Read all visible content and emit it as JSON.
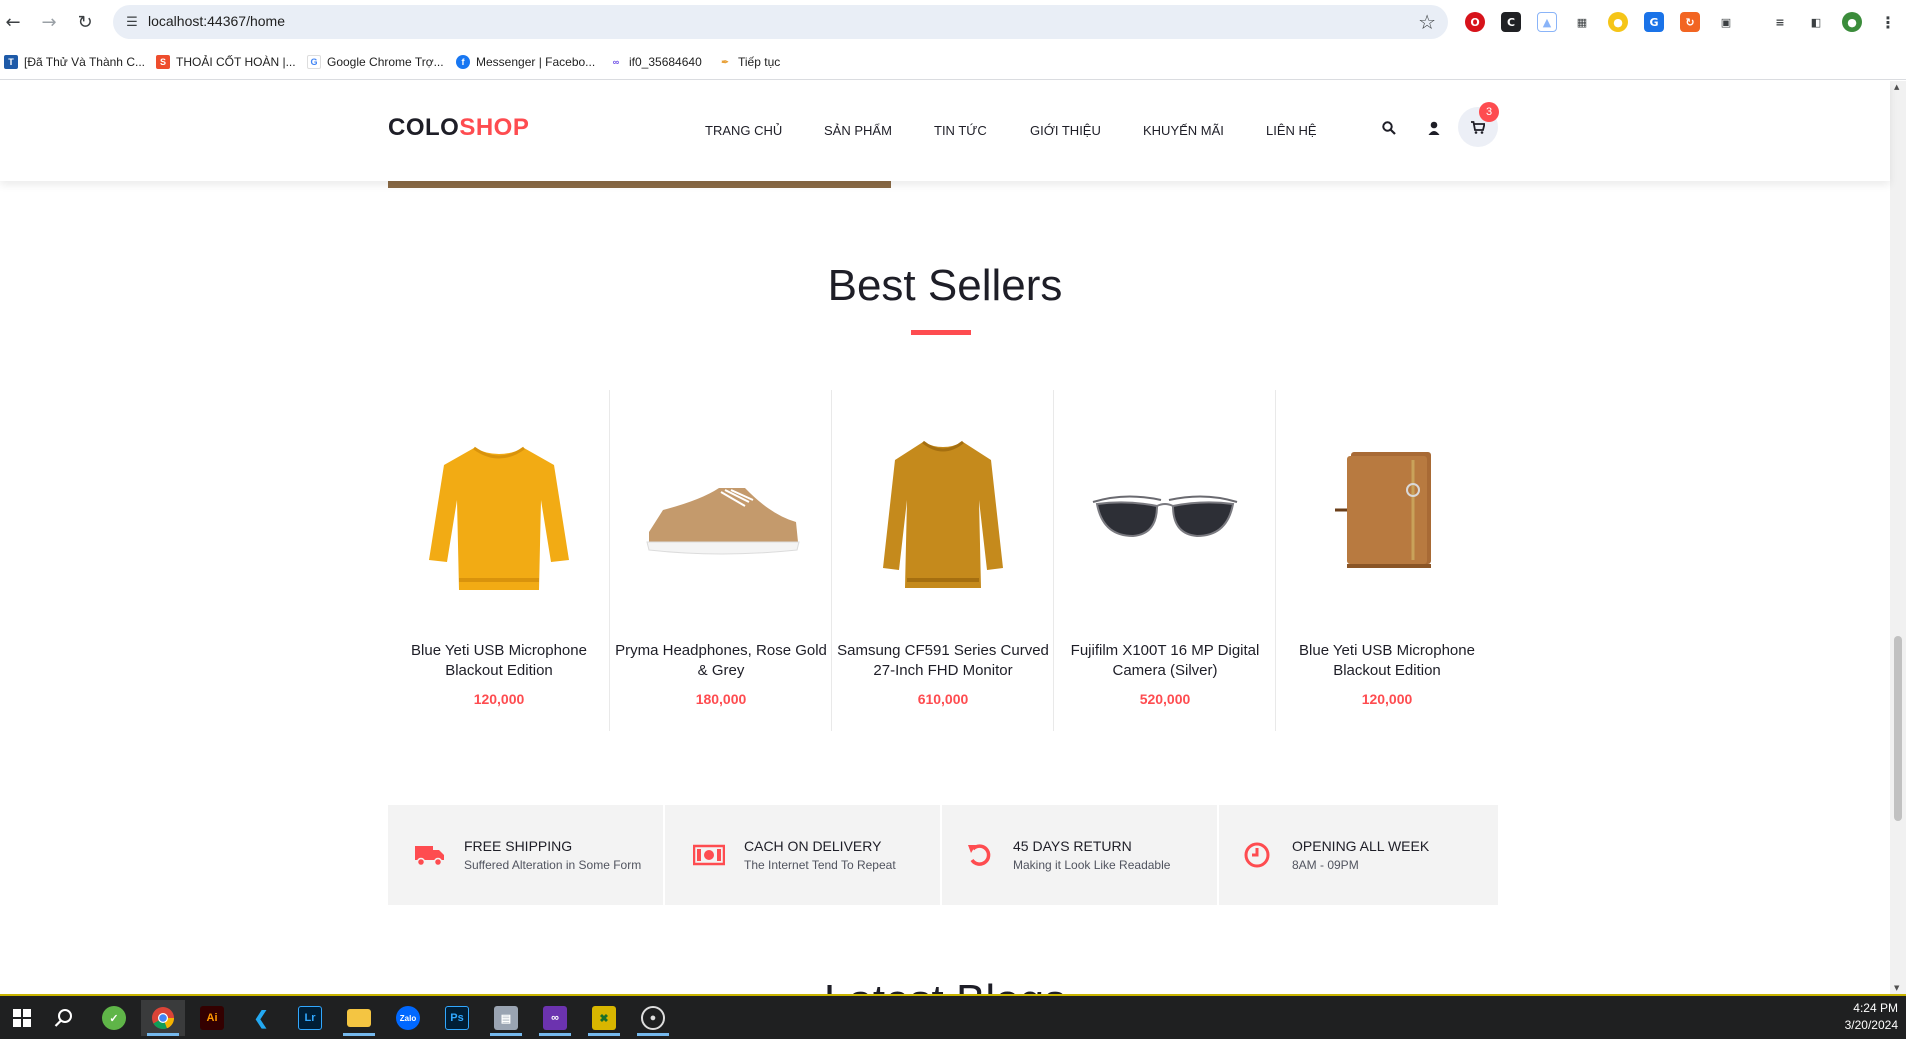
{
  "browser": {
    "url": "localhost:44367/home",
    "bookmarks": [
      {
        "label": "[Đã Thử Và Thành C...",
        "icon": "blue-square-icon",
        "color": "#1e5aa8"
      },
      {
        "label": "THOẢI CỐT HOÀN |...",
        "icon": "shopee-icon",
        "color": "#ee4d2d"
      },
      {
        "label": "Google Chrome Trợ...",
        "icon": "google-icon",
        "color": "#4285f4"
      },
      {
        "label": "Messenger | Facebo...",
        "icon": "facebook-icon",
        "color": "#1877f2"
      },
      {
        "label": "if0_35684640",
        "icon": "infinity-icon",
        "color": "#6b4ce6"
      },
      {
        "label": "Tiếp tục",
        "icon": "brush-icon",
        "color": "#e8a13a"
      }
    ]
  },
  "site": {
    "logo_part1": "COLO",
    "logo_part2": "SHOP",
    "menu": [
      "TRANG CHỦ",
      "SẢN PHẨM",
      "TIN TỨC",
      "GIỚI THIỆU",
      "KHUYẾN MÃI",
      "LIÊN HỆ"
    ],
    "cart_count": "3",
    "accent_color": "#fe4c50"
  },
  "best_sellers": {
    "title": "Best Sellers",
    "products": [
      {
        "name": "Blue Yeti USB Microphone Blackout Edition",
        "price": "120,000",
        "image": "yellow-sweater"
      },
      {
        "name": "Pryma Headphones, Rose Gold & Grey",
        "price": "180,000",
        "image": "tan-sneaker"
      },
      {
        "name": "Samsung CF591 Series Curved 27-Inch FHD Monitor",
        "price": "610,000",
        "image": "mustard-sweater"
      },
      {
        "name": "Fujifilm X100T 16 MP Digital Camera (Silver)",
        "price": "520,000",
        "image": "aviator-sunglasses"
      },
      {
        "name": "Blue Yeti USB Microphone Blackout Edition",
        "price": "120,000",
        "image": "brown-wallet"
      }
    ]
  },
  "benefits": [
    {
      "title": "FREE SHIPPING",
      "subtitle": "Suffered Alteration in Some Form",
      "icon": "truck-icon"
    },
    {
      "title": "CACH ON DELIVERY",
      "subtitle": "The Internet Tend To Repeat",
      "icon": "money-icon"
    },
    {
      "title": "45 DAYS RETURN",
      "subtitle": "Making it Look Like Readable",
      "icon": "undo-icon"
    },
    {
      "title": "OPENING ALL WEEK",
      "subtitle": "8AM - 09PM",
      "icon": "clock-icon"
    }
  ],
  "next_section_title": "Latest Blogs",
  "taskbar": {
    "time": "4:24 PM",
    "date": "3/20/2024"
  }
}
